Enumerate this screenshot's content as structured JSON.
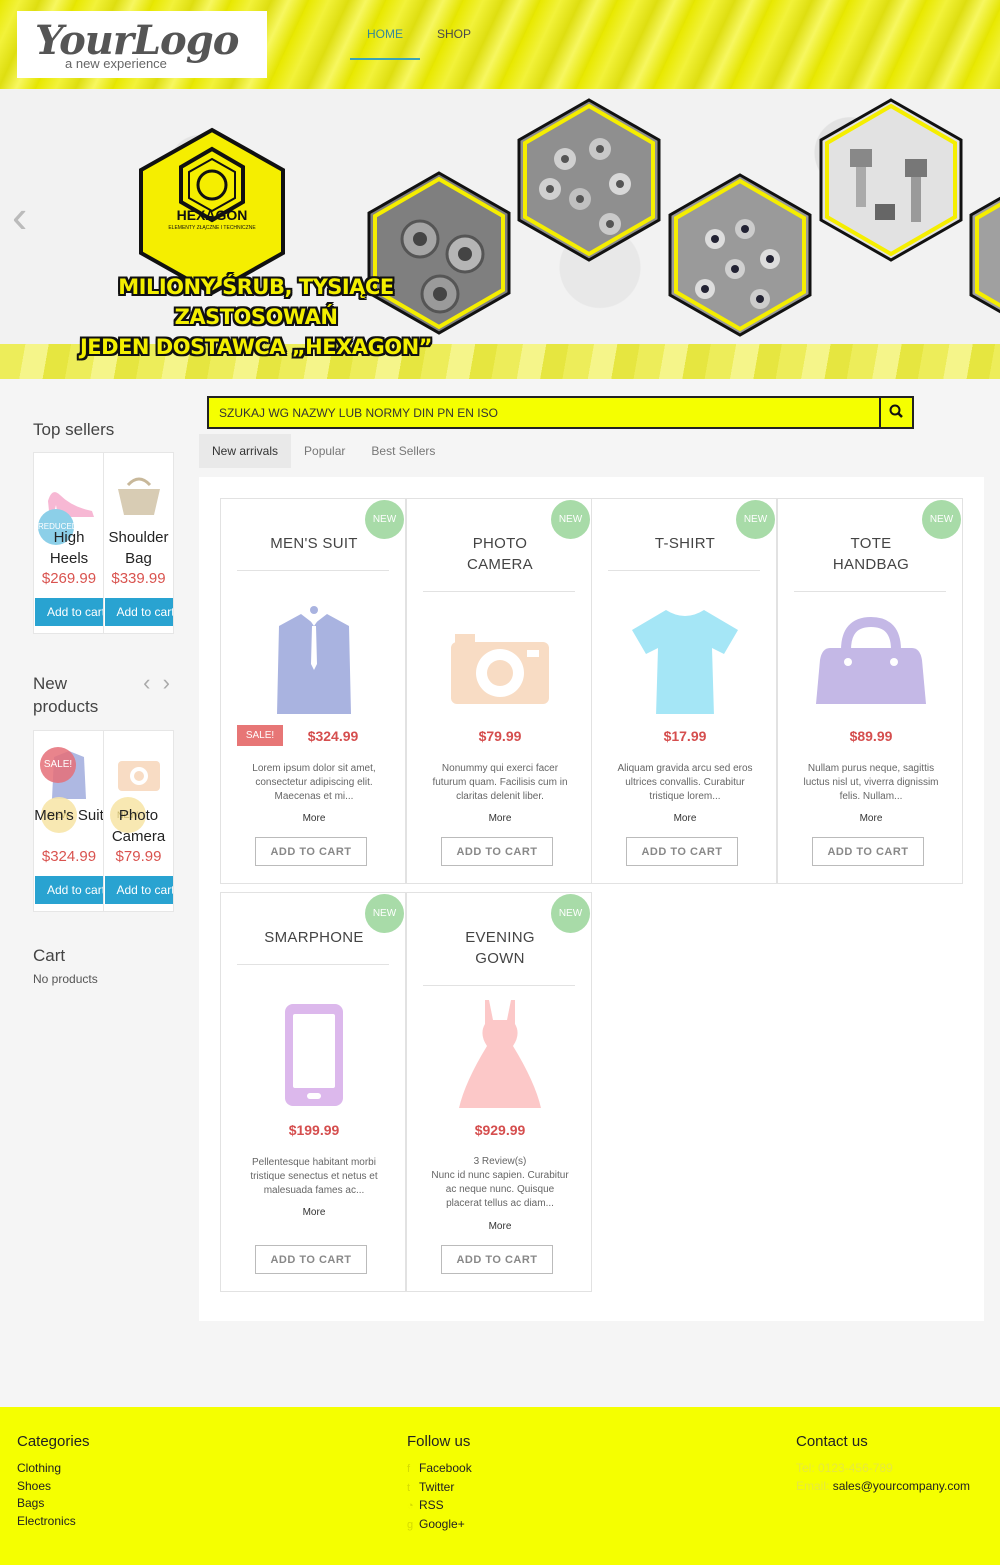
{
  "header": {
    "logo_main": "YourLogo",
    "logo_sub": "a new experience",
    "nav": [
      "HOME",
      "SHOP"
    ]
  },
  "banner": {
    "brand": "HEXAGON",
    "brand_sub": "ELEMENTY ZŁĄCZNE I TECHNICZNE",
    "tagline_1": "MILIONY ŚRUB, TYSIĄCE ZASTOSOWAŃ",
    "tagline_2": "JEDEN DOSTAWCA „HEXAGON”",
    "prev_icon": "chevron-left-icon"
  },
  "search": {
    "placeholder": "SZUKAJ WG NAZWY LUB NORMY DIN PN EN ISO",
    "icon": "search-icon"
  },
  "tabs": [
    "New arrivals",
    "Popular",
    "Best Sellers"
  ],
  "sidebar": {
    "top_sellers": {
      "title": "Top sellers",
      "items": [
        {
          "name": "High Heels",
          "price": "$269.99",
          "badge": "REDUCED PRICE",
          "cart": "Add to cart"
        },
        {
          "name": "Shoulder Bag",
          "price": "$339.99",
          "cart": "Add to cart"
        }
      ]
    },
    "new_products": {
      "title": "New products",
      "items": [
        {
          "name": "Men's Suit",
          "price": "$324.99",
          "badge": "SALE!",
          "badge2": "NEW",
          "cart": "Add to cart"
        },
        {
          "name": "Photo Camera",
          "price": "$79.99",
          "badge2": "NEW",
          "cart": "Add to cart"
        }
      ]
    },
    "cart": {
      "title": "Cart",
      "empty": "No products"
    }
  },
  "products": [
    {
      "title_1": "MEN'S SUIT",
      "title_2": "",
      "price": "$324.99",
      "sale": "SALE!",
      "badge": "NEW",
      "desc_1": "Lorem ipsum dolor sit amet,",
      "desc_2": "consectetur adipiscing elit.",
      "desc_3": "Maecenas et mi...",
      "more": "More",
      "button": "ADD TO CART",
      "color": "#a9b3e0"
    },
    {
      "title_1": "PHOTO",
      "title_2": "CAMERA",
      "price": "$79.99",
      "badge": "NEW",
      "desc_1": "Nonummy qui exerci facer",
      "desc_2": "futurum quam. Facilisis cum in",
      "desc_3": "claritas delenit liber.",
      "more": "More",
      "button": "ADD TO CART",
      "color": "#f8dcc4"
    },
    {
      "title_1": "T-SHIRT",
      "title_2": "",
      "price": "$17.99",
      "badge": "NEW",
      "desc_1": "Aliquam gravida arcu sed eros",
      "desc_2": "ultrices convallis. Curabitur",
      "desc_3": "tristique lorem...",
      "more": "More",
      "button": "ADD TO CART",
      "color": "#a5e6f6"
    },
    {
      "title_1": "TOTE",
      "title_2": "HANDBAG",
      "price": "$89.99",
      "badge": "NEW",
      "desc_1": "Nullam purus neque, sagittis",
      "desc_2": "luctus nisl ut, viverra dignissim",
      "desc_3": "felis. Nullam...",
      "more": "More",
      "button": "ADD TO CART",
      "color": "#c4b8e6"
    },
    {
      "title_1": "SMARPHONE",
      "title_2": "",
      "price": "$199.99",
      "badge": "NEW",
      "desc_1": "Pellentesque habitant morbi",
      "desc_2": "tristique senectus et netus et",
      "desc_3": "malesuada fames ac...",
      "more": "More",
      "button": "ADD TO CART",
      "color": "#dcb8ec"
    },
    {
      "title_1": "EVENING",
      "title_2": "GOWN",
      "price": "$929.99",
      "badge": "NEW",
      "reviews": "3 Review(s)",
      "desc_1": "Nunc id nunc sapien. Curabitur",
      "desc_2": "ac neque nunc. Quisque",
      "desc_3": "placerat tellus ac diam...",
      "more": "More",
      "button": "ADD TO CART",
      "color": "#fcc8c8"
    }
  ],
  "footer": {
    "categories": {
      "title": "Categories",
      "links": [
        "Clothing",
        "Shoes",
        "Bags",
        "Electronics"
      ]
    },
    "follow": {
      "title": "Follow us",
      "links": [
        "Facebook",
        "Twitter",
        "RSS",
        "Google+"
      ],
      "icons": [
        "facebook-icon",
        "twitter-icon",
        "rss-icon",
        "google-plus-icon"
      ]
    },
    "contact": {
      "title": "Contact us",
      "tel_label": "Tel:",
      "tel": "0123-456-789",
      "email_label": "Email:",
      "email": "sales@yourcompany.com"
    }
  },
  "colors": {
    "accent": "#f5ff00",
    "price": "#d54e4e",
    "button_blue": "#29a3d1",
    "new_badge": "#a8dba8"
  }
}
